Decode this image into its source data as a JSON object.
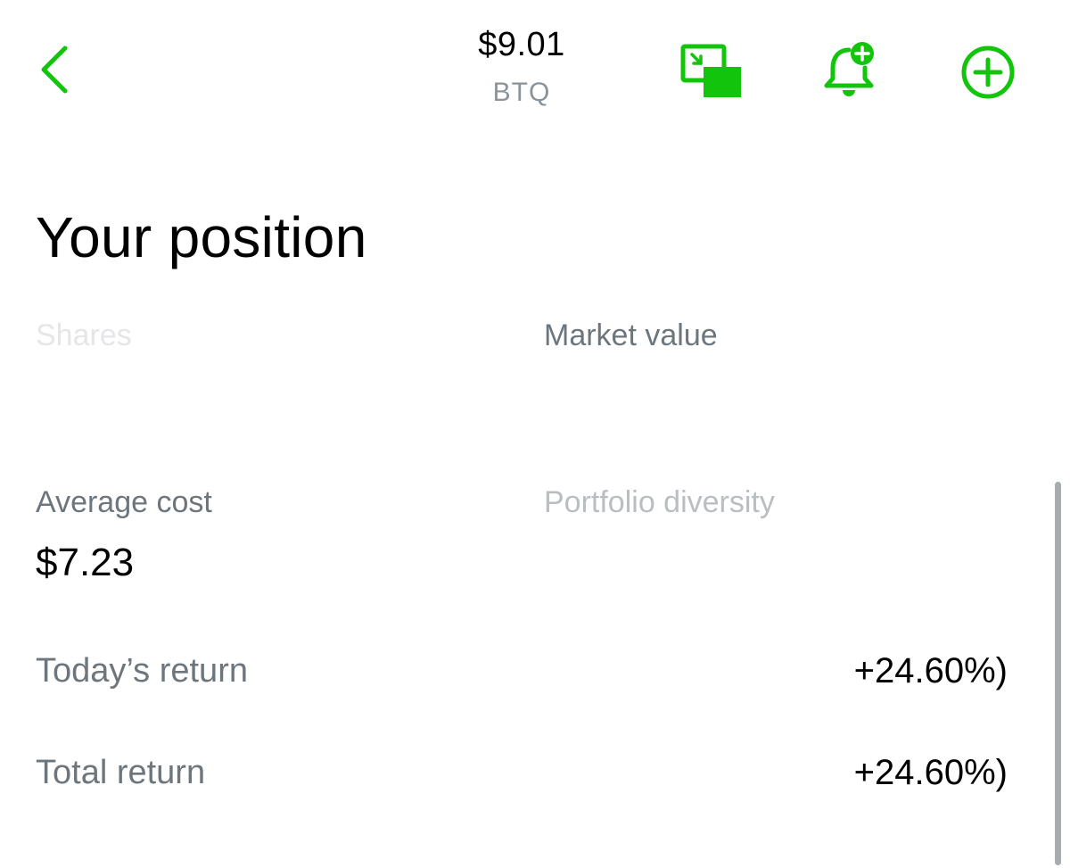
{
  "header": {
    "price": "$9.01",
    "ticker": "BTQ"
  },
  "icons": {
    "back": "chevron-left-icon",
    "pip": "picture-in-picture-icon",
    "alert": "bell-plus-icon",
    "add": "plus-circle-icon"
  },
  "colors": {
    "accent": "#13c40d",
    "muted_text": "#6d767c"
  },
  "position": {
    "title": "Your position",
    "shares_label": "Shares",
    "shares_value": "",
    "market_value_label": "Market value",
    "market_value_value": "",
    "average_cost_label": "Average cost",
    "average_cost_value": "$7.23",
    "portfolio_diversity_label": "Portfolio diversity",
    "portfolio_diversity_value": "",
    "todays_return_label": "Today’s return",
    "todays_return_amount": "",
    "todays_return_pct": "+24.60%)",
    "total_return_label": "Total return",
    "total_return_amount": "",
    "total_return_pct": "+24.60%)"
  }
}
